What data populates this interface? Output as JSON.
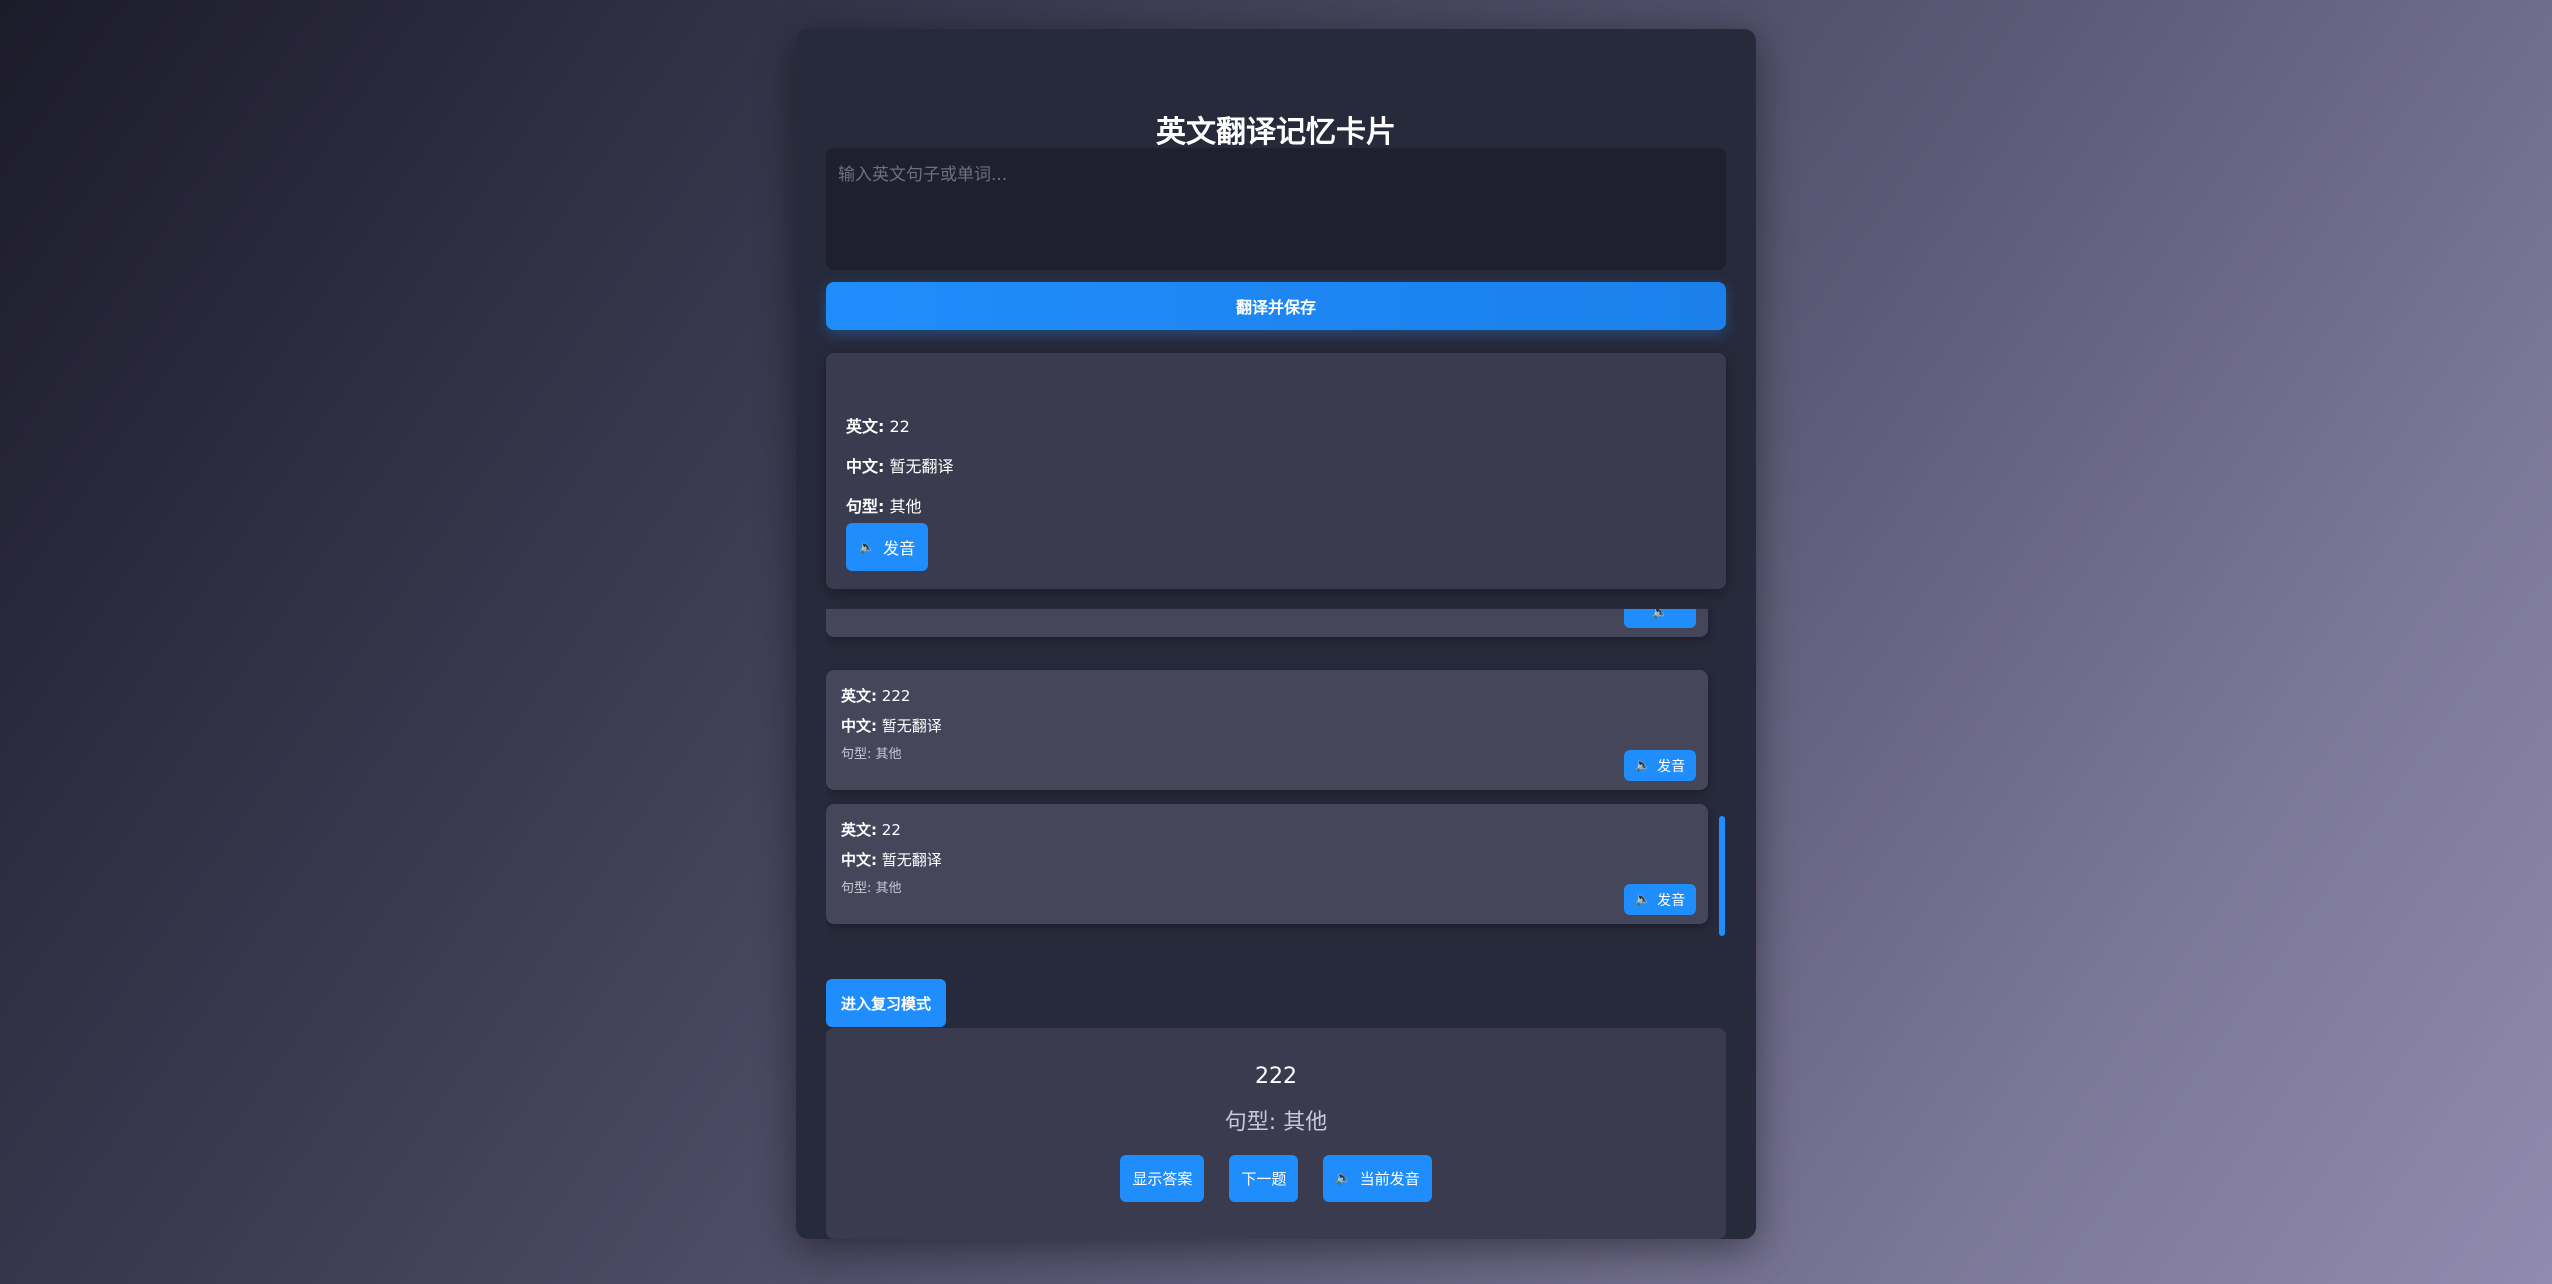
{
  "app": {
    "title": "英文翻译记忆卡片"
  },
  "input": {
    "placeholder": "输入英文句子或单词...",
    "value": ""
  },
  "translate_button": "翻译并保存",
  "featured_card": {
    "en_label": "英文:",
    "en_value": "22",
    "zh_label": "中文:",
    "zh_value": "暂无翻译",
    "type_label": "句型:",
    "type_value": "其他",
    "speak_label": "发音",
    "speak_icon": "speaker-icon"
  },
  "list": {
    "items": [
      {
        "en_label": "英文:",
        "en_value": "222",
        "zh_label": "中文:",
        "zh_value": "暂无翻译",
        "type_text": "句型: 其他",
        "speak_label": "发音"
      },
      {
        "en_label": "英文:",
        "en_value": "22",
        "zh_label": "中文:",
        "zh_value": "暂无翻译",
        "type_text": "句型: 其他",
        "speak_label": "发音"
      }
    ]
  },
  "review_button": "进入复习模式",
  "review": {
    "word": "222",
    "type_text": "句型: 其他",
    "show_answer": "显示答案",
    "next": "下一题",
    "speak_current": "当前发音"
  },
  "colors": {
    "accent": "#1f8dfc",
    "panel": "#272a3b",
    "card": "#3a3b4f",
    "list_card": "#46465b"
  }
}
